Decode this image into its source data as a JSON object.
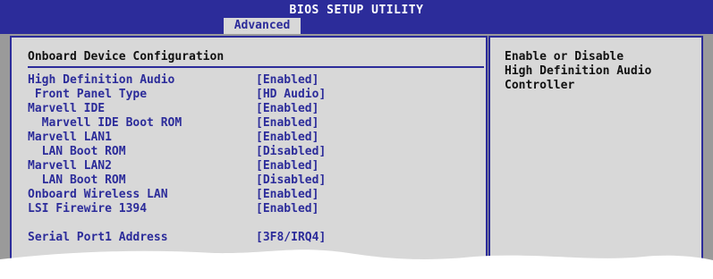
{
  "header": {
    "title": "BIOS SETUP UTILITY",
    "active_tab": "Advanced"
  },
  "main": {
    "section_title": "Onboard Device Configuration",
    "items": [
      {
        "label": "High Definition Audio",
        "value": "[Enabled]"
      },
      {
        "label": " Front Panel Type",
        "value": "[HD Audio]"
      },
      {
        "label": "Marvell IDE",
        "value": "[Enabled]"
      },
      {
        "label": "  Marvell IDE Boot ROM",
        "value": "[Enabled]"
      },
      {
        "label": "Marvell LAN1",
        "value": "[Enabled]"
      },
      {
        "label": "  LAN Boot ROM",
        "value": "[Disabled]"
      },
      {
        "label": "Marvell LAN2",
        "value": "[Enabled]"
      },
      {
        "label": "  LAN Boot ROM",
        "value": "[Disabled]"
      },
      {
        "label": "Onboard Wireless LAN",
        "value": "[Enabled]"
      },
      {
        "label": "LSI Firewire 1394",
        "value": "[Enabled]"
      },
      {
        "label": "Serial Port1 Address",
        "value": "[3F8/IRQ4]"
      }
    ]
  },
  "help": {
    "lines": [
      "Enable or Disable",
      "High Definition Audio",
      "Controller"
    ]
  }
}
